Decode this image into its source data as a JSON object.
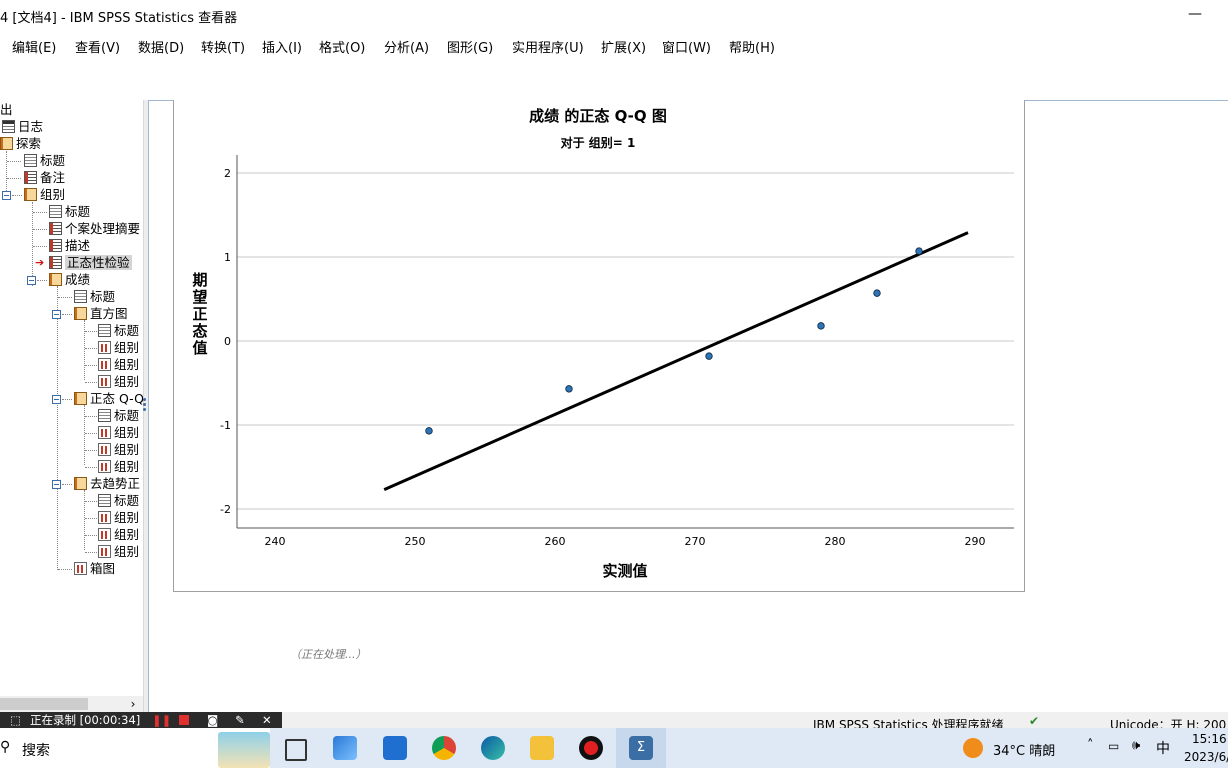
{
  "window": {
    "title": "4 [文档4] - IBM SPSS Statistics 查看器",
    "minimize": "—"
  },
  "menu": [
    {
      "label": "编辑(E)"
    },
    {
      "label": "查看(V)"
    },
    {
      "label": "数据(D)"
    },
    {
      "label": "转换(T)"
    },
    {
      "label": "插入(I)"
    },
    {
      "label": "格式(O)"
    },
    {
      "label": "分析(A)"
    },
    {
      "label": "图形(G)"
    },
    {
      "label": "实用程序(U)"
    },
    {
      "label": "扩展(X)"
    },
    {
      "label": "窗口(W)"
    },
    {
      "label": "帮助(H)"
    }
  ],
  "nav": {
    "items": [
      {
        "label": "出",
        "icon": "none"
      },
      {
        "label": "日志",
        "icon": "note"
      },
      {
        "label": "探索",
        "icon": "book"
      },
      {
        "label": "标题",
        "icon": "doc"
      },
      {
        "label": "备注",
        "icon": "table"
      },
      {
        "label": "组别",
        "icon": "book"
      },
      {
        "label": "标题",
        "icon": "doc"
      },
      {
        "label": "个案处理摘要",
        "icon": "table"
      },
      {
        "label": "描述",
        "icon": "table"
      },
      {
        "label": "正态性检验",
        "icon": "table",
        "selected": true
      },
      {
        "label": "成绩",
        "icon": "book"
      },
      {
        "label": "标题",
        "icon": "doc"
      },
      {
        "label": "直方图",
        "icon": "book"
      },
      {
        "label": "标题",
        "icon": "doc"
      },
      {
        "label": "组别",
        "icon": "chart"
      },
      {
        "label": "组别",
        "icon": "chart"
      },
      {
        "label": "组别",
        "icon": "chart"
      },
      {
        "label": "正态 Q-Q",
        "icon": "book"
      },
      {
        "label": "标题",
        "icon": "doc"
      },
      {
        "label": "组别",
        "icon": "chart"
      },
      {
        "label": "组别",
        "icon": "chart"
      },
      {
        "label": "组别",
        "icon": "chart"
      },
      {
        "label": "去趋势正",
        "icon": "book"
      },
      {
        "label": "标题",
        "icon": "doc"
      },
      {
        "label": "组别",
        "icon": "chart"
      },
      {
        "label": "组别",
        "icon": "chart"
      },
      {
        "label": "组别",
        "icon": "chart"
      },
      {
        "label": "箱图",
        "icon": "chart"
      }
    ]
  },
  "processing_text": "（正在处理...）",
  "chart_data": {
    "type": "scatter",
    "title": "成绩 的正态 Q-Q 图",
    "subtitle": "对于 组别= 1",
    "xlabel": "实测值",
    "ylabel": "期望正态值",
    "xlim": [
      237,
      1013
    ],
    "x_ticks": [
      240,
      250,
      260,
      270,
      280,
      290
    ],
    "y_ticks": [
      2,
      1,
      0,
      -1,
      -2
    ],
    "ylim": [
      -2.2,
      2.2
    ],
    "grid": "horizontal",
    "points": [
      {
        "x": 251,
        "y": -1.07
      },
      {
        "x": 261,
        "y": -0.57
      },
      {
        "x": 271,
        "y": -0.18
      },
      {
        "x": 279,
        "y": 0.18
      },
      {
        "x": 283,
        "y": 0.57
      },
      {
        "x": 286,
        "y": 1.07
      }
    ],
    "reference_line": {
      "x": [
        247.8,
        289.5
      ],
      "y": [
        -1.77,
        1.29
      ]
    }
  },
  "status": {
    "processor": "IBM SPSS Statistics 处理程序就绪",
    "unicode": "Unicode：开   H: 200"
  },
  "recording": {
    "text": "正在录制 [00:00:34]"
  },
  "taskbar": {
    "search": "搜索",
    "weather": "34°C 晴朗",
    "ime": "中",
    "time": "15:16",
    "date": "2023/6/"
  }
}
